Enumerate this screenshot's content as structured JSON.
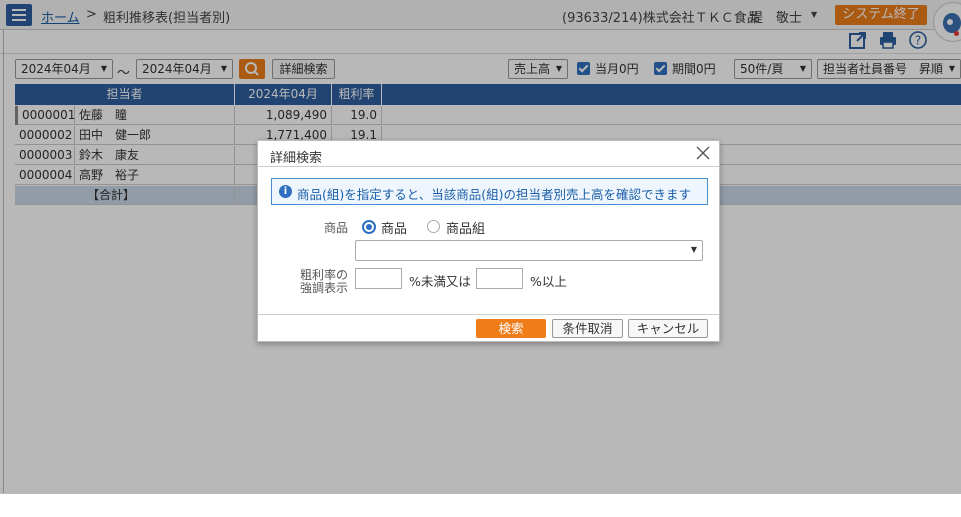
{
  "header": {
    "home_label": "ホーム",
    "separator": ">",
    "current_page": "粗利推移表(担当者別)",
    "company": "(93633/214)株式会社ＴＫＣ食品",
    "user": "堤　敬士",
    "system_exit_label": "システム終了"
  },
  "filters": {
    "from_month": "2024年04月",
    "tilde": "～",
    "to_month": "2024年04月",
    "detail_search_label": "詳細検索",
    "metric": "売上高",
    "current_zero_label": "当月0円",
    "period_zero_label": "期間0円",
    "per_page": "50件/頁",
    "sort": "担当者社員番号　昇順"
  },
  "table": {
    "headers": [
      "担当者",
      "2024年04月",
      "粗利率"
    ],
    "rows": [
      {
        "code": "0000001",
        "name": "佐藤　瞳",
        "value": "1,089,490",
        "rate": "19.0"
      },
      {
        "code": "0000002",
        "name": "田中　健一郎",
        "value": "1,771,400",
        "rate": "19.1"
      },
      {
        "code": "0000003",
        "name": "鈴木　康友",
        "value": "",
        "rate": ""
      },
      {
        "code": "0000004",
        "name": "高野　裕子",
        "value": "",
        "rate": ""
      }
    ],
    "total_label": "【合計】"
  },
  "modal": {
    "title": "詳細検索",
    "info": "商品(組)を指定すると、当該商品(組)の担当者別売上高を確認できます",
    "product_label": "商品",
    "radio_product": "商品",
    "radio_group": "商品組",
    "rate_label_line1": "粗利率の",
    "rate_label_line2": "強調表示",
    "less_than_label": "%未満又は",
    "more_than_label": "%以上",
    "search_label": "検索",
    "clear_label": "条件取消",
    "cancel_label": "キャンセル"
  },
  "colors": {
    "accent": "#2e5f9e",
    "orange": "#ee7d1a"
  }
}
